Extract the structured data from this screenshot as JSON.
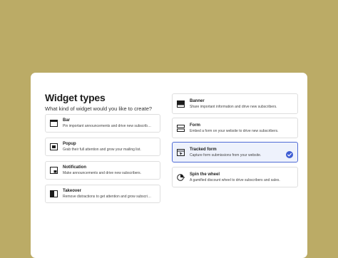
{
  "header": {
    "title": "Widget types",
    "subtitle": "What kind of widget would you like to create?"
  },
  "left_widgets": [
    {
      "name": "Bar",
      "description": "Pin important announcements and drive new subscribers",
      "icon": "bar-widget-icon"
    },
    {
      "name": "Popup",
      "description": "Grab their full attention and grow your mailing list.",
      "icon": "popup-widget-icon"
    },
    {
      "name": "Notification",
      "description": "Make announcements and drive new subscribers.",
      "icon": "notification-widget-icon"
    },
    {
      "name": "Takeover",
      "description": "Remove distractions to get attention and grow subscribers",
      "icon": "takeover-widget-icon"
    }
  ],
  "right_widgets": [
    {
      "name": "Banner",
      "description": "Share important information and drive new subscribers.",
      "icon": "banner-widget-icon"
    },
    {
      "name": "Form",
      "description": "Embed a form on your website to drive new subscribers.",
      "icon": "form-widget-icon"
    },
    {
      "name": "Tracked form",
      "description": "Capture form submissions from your website.",
      "icon": "tracked-form-icon",
      "selected": true
    },
    {
      "name": "Spin the wheel",
      "description": "A gamified discount wheel to drive subscribers and sales.",
      "icon": "spin-wheel-icon"
    }
  ],
  "colors": {
    "background": "#bbab66",
    "panel": "#ffffff",
    "selected_border": "#4f6bd6",
    "selected_fill": "#eef2fc",
    "check": "#3f5ed4"
  }
}
